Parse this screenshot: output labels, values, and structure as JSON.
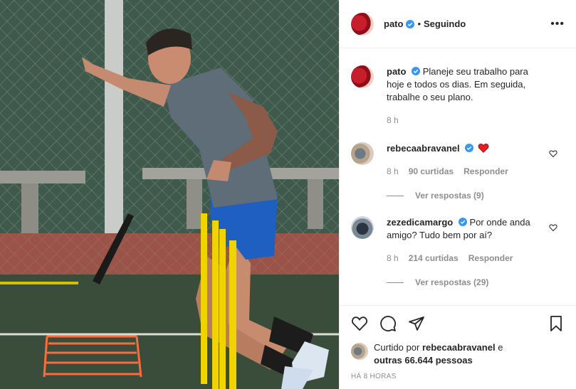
{
  "post": {
    "author": "pato",
    "follow_status": "Seguindo",
    "dot": "•",
    "more": "•••"
  },
  "caption": {
    "username": "pato",
    "text": "Planeje seu trabalho para hoje e todos os dias. Em seguida, trabalhe o seu plano.",
    "time": "8 h"
  },
  "comments": [
    {
      "username": "rebecaabravanel",
      "text": "",
      "emoji": "heart-emoji",
      "time": "8 h",
      "likes": "90 curtidas",
      "reply": "Responder",
      "view_replies": "Ver respostas (9)"
    },
    {
      "username": "zezedicamargo",
      "text": "Por onde anda amigo? Tudo bem por aí?",
      "time": "8 h",
      "likes": "214 curtidas",
      "reply": "Responder",
      "view_replies": "Ver respostas (29)"
    }
  ],
  "liked_by": {
    "prefix": "Curtido por",
    "user": "rebecaabravanel",
    "conj": "e",
    "others": "outras 66.644 pessoas"
  },
  "timestamp": "HÁ 8 HORAS",
  "colors": {
    "verified": "#3897f0",
    "heart": "#ed4956",
    "muted": "#8e8e8e",
    "text": "#262626",
    "border": "#efefef"
  },
  "icons": [
    "heart-icon",
    "comment-icon",
    "share-icon",
    "bookmark-icon",
    "verified-icon",
    "more-icon"
  ]
}
